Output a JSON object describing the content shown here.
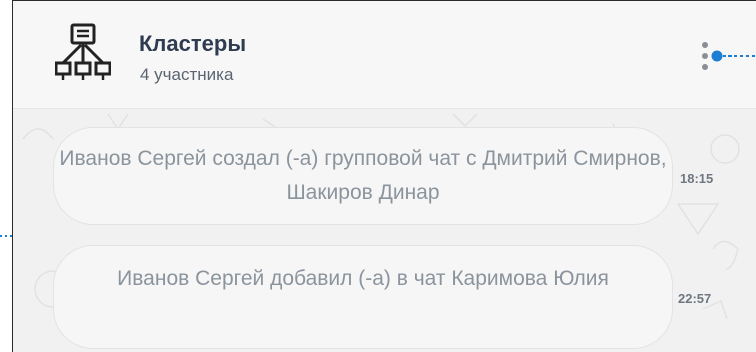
{
  "chat": {
    "title": "Кластеры",
    "subtitle": "4 участника"
  },
  "messages": [
    {
      "text": "Иванов Сергей создал (-а) групповой чат с Дмитрий Смирнов, Шакиров Динар",
      "time": "18:15"
    },
    {
      "text": "Иванов Сергей добавил (-а) в чат Каримова Юлия",
      "time": "22:57"
    }
  ],
  "icons": {
    "group": "cluster-network-icon",
    "menu": "more-vertical-icon"
  },
  "colors": {
    "title": "#2f3c4f",
    "message_text": "#8b949d",
    "accent": "#1a7fd4"
  }
}
